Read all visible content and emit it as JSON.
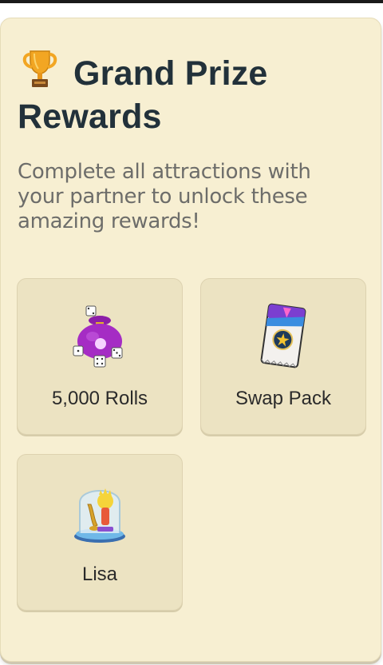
{
  "header": {
    "title": "Grand Prize Rewards",
    "trophy_icon": "trophy-icon",
    "subtitle": "Complete all attractions with your partner to unlock these amazing rewards!"
  },
  "rewards": [
    {
      "label": "5,000 Rolls",
      "icon": "dice-bag-icon"
    },
    {
      "label": "Swap Pack",
      "icon": "swap-pack-icon"
    },
    {
      "label": "Lisa",
      "icon": "lisa-figure-icon"
    }
  ],
  "colors": {
    "card_bg": "#f7efd2",
    "tile_bg": "#ece3c2",
    "title": "#22313a",
    "subtitle": "#6d6d6a"
  }
}
